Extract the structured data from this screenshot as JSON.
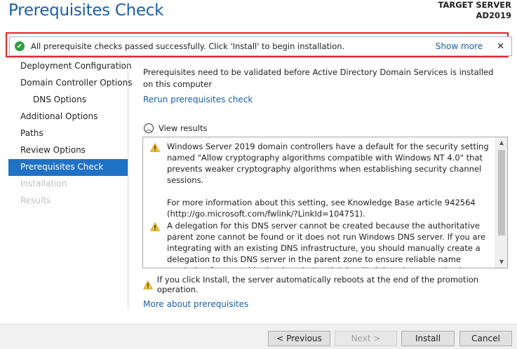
{
  "header": {
    "title": "Prerequisites Check",
    "target_label": "TARGET SERVER",
    "target_name": "AD2019"
  },
  "banner": {
    "message": "All prerequisite checks passed successfully.  Click 'Install' to begin installation.",
    "show_more": "Show more",
    "close": "✕"
  },
  "nav": {
    "items": [
      {
        "label": "Deployment Configuration",
        "state": "normal"
      },
      {
        "label": "Domain Controller Options",
        "state": "normal"
      },
      {
        "label": "DNS Options",
        "state": "sub"
      },
      {
        "label": "Additional Options",
        "state": "normal"
      },
      {
        "label": "Paths",
        "state": "normal"
      },
      {
        "label": "Review Options",
        "state": "normal"
      },
      {
        "label": "Prerequisites Check",
        "state": "active"
      },
      {
        "label": "Installation",
        "state": "disabled"
      },
      {
        "label": "Results",
        "state": "disabled"
      }
    ]
  },
  "main": {
    "intro": "Prerequisites need to be validated before Active Directory Domain Services is installed on this computer",
    "rerun_link": "Rerun prerequisites check",
    "view_results": "View results",
    "results": [
      {
        "icon": "warning-icon",
        "paragraphs": [
          "Windows Server 2019 domain controllers have a default for the security setting named \"Allow cryptography algorithms compatible with Windows NT 4.0\" that prevents weaker cryptography algorithms when establishing security channel sessions.",
          "For more information about this setting, see Knowledge Base article 942564 (http://go.microsoft.com/fwlink/?LinkId=104751)."
        ]
      },
      {
        "icon": "warning-icon",
        "paragraphs": [
          "A delegation for this DNS server cannot be created because the authoritative parent zone cannot be found or it does not run Windows DNS server. If you are integrating with an existing DNS infrastructure, you should manually create a delegation to this DNS server in the parent zone to ensure reliable name resolution from outside the domain \"testlab.local\". Otherwise, no action is required."
        ]
      }
    ],
    "reboot_note": "If you click Install, the server automatically reboots at the end of the promotion operation.",
    "more_link": "More about prerequisites"
  },
  "footer": {
    "previous": "< Previous",
    "next": "Next >",
    "install": "Install",
    "cancel": "Cancel"
  },
  "colors": {
    "accent": "#1f72c4",
    "title": "#1a5fa8",
    "success": "#2f9e3f",
    "warning": "#f2c230",
    "highlight_border": "#e0242c"
  }
}
